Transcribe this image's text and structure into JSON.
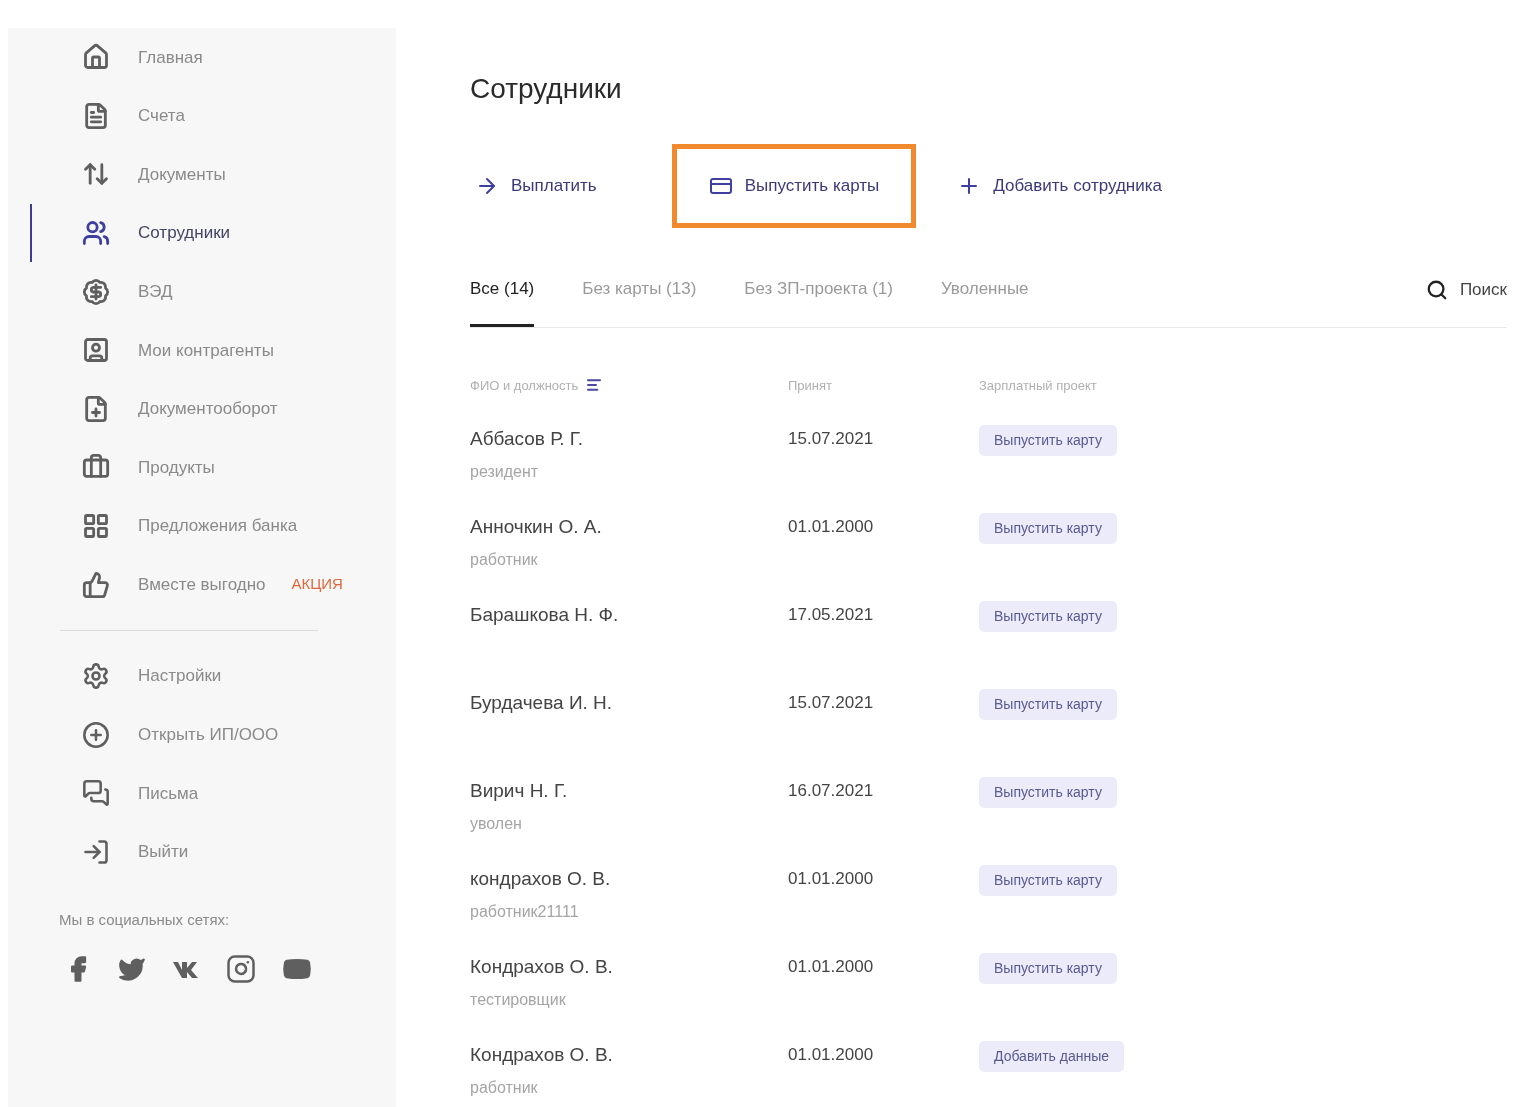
{
  "sidebar": {
    "items": [
      {
        "label": "Главная",
        "selected": false
      },
      {
        "label": "Счета",
        "selected": false
      },
      {
        "label": "Документы",
        "selected": false
      },
      {
        "label": "Сотрудники",
        "selected": true
      },
      {
        "label": "ВЭД",
        "selected": false
      },
      {
        "label": "Мои контрагенты",
        "selected": false
      },
      {
        "label": "Документооборот",
        "selected": false
      },
      {
        "label": "Продукты",
        "selected": false
      },
      {
        "label": "Предложения банка",
        "selected": false
      },
      {
        "label": "Вместе выгодно",
        "selected": false,
        "badge": "АКЦИЯ"
      }
    ],
    "bottom_items": [
      {
        "label": "Настройки"
      },
      {
        "label": "Открыть ИП/ООО"
      },
      {
        "label": "Письма"
      },
      {
        "label": "Выйти"
      }
    ],
    "social_label": "Мы в социальных сетях:"
  },
  "page": {
    "title": "Сотрудники",
    "actions": [
      {
        "label": "Выплатить",
        "highlighted": false
      },
      {
        "label": "Выпустить карты",
        "highlighted": true
      },
      {
        "label": "Добавить сотрудника",
        "highlighted": false
      }
    ],
    "tabs": [
      {
        "label": "Все (14)",
        "selected": true
      },
      {
        "label": "Без карты (13)",
        "selected": false
      },
      {
        "label": "Без ЗП-проекта (1)",
        "selected": false
      },
      {
        "label": "Уволенные",
        "selected": false
      }
    ],
    "search": {
      "label": "Поиск"
    },
    "table": {
      "columns": [
        "ФИО и должность",
        "Принят",
        "Зарплатный проект"
      ],
      "rows": [
        {
          "name": "Аббасов Р. Г.",
          "position": "резидент",
          "hired": "15.07.2021",
          "action": "Выпустить карту"
        },
        {
          "name": "Анночкин О. А.",
          "position": "работник",
          "hired": "01.01.2000",
          "action": "Выпустить карту"
        },
        {
          "name": "Барашкова Н. Ф.",
          "hired": "17.05.2021",
          "action": "Выпустить карту"
        },
        {
          "name": "Бурдачева И. Н.",
          "hired": "15.07.2021",
          "action": "Выпустить карту"
        },
        {
          "name": "Вирич Н. Г.",
          "position": "уволен",
          "hired": "16.07.2021",
          "action": "Выпустить карту"
        },
        {
          "name": "кондрахов О. В.",
          "position": "работник21111",
          "hired": "01.01.2000",
          "action": "Выпустить карту"
        },
        {
          "name": "Кондрахов О. В.",
          "position": "тестировщик",
          "hired": "01.01.2000",
          "action": "Выпустить карту"
        },
        {
          "name": "Кондрахов О. В.",
          "position": "работник",
          "hired": "01.01.2000",
          "action": "Добавить данные"
        }
      ]
    }
  }
}
